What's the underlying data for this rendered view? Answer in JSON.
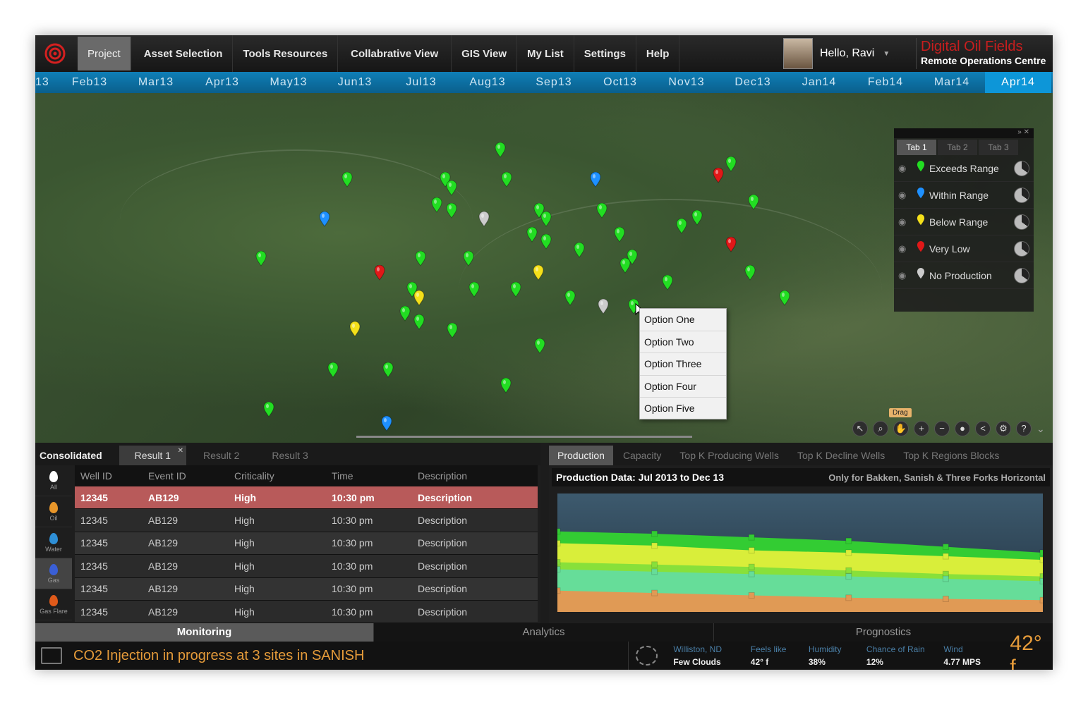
{
  "nav": {
    "items": [
      "Project",
      "Asset Selection",
      "Tools Resources",
      "Collabrative View",
      "GIS View",
      "My List",
      "Settings",
      "Help"
    ],
    "active": "Project",
    "user_greeting": "Hello, Ravi",
    "brand_title": "Digital Oil Fields",
    "brand_subtitle": "Remote Operations Centre"
  },
  "timeline": {
    "months": [
      "13",
      "Feb13",
      "Mar13",
      "Apr13",
      "May13",
      "Jun13",
      "Jul13",
      "Aug13",
      "Sep13",
      "Oct13",
      "Nov13",
      "Dec13",
      "Jan14",
      "Feb14",
      "Mar14",
      "Apr14"
    ],
    "active": "Apr14"
  },
  "legend": {
    "tabs": [
      "Tab 1",
      "Tab 2",
      "Tab 3"
    ],
    "items": [
      {
        "label": "Exceeds Range",
        "color": "#22dd22"
      },
      {
        "label": "Within Range",
        "color": "#1e90ff"
      },
      {
        "label": "Below Range",
        "color": "#f4e01a"
      },
      {
        "label": "Very Low",
        "color": "#e01818"
      },
      {
        "label": "No Production",
        "color": "#cccccc"
      }
    ]
  },
  "context_menu": [
    "Option One",
    "Option Two",
    "Option Three",
    "Option Four",
    "Option Five"
  ],
  "map_tools": {
    "drag_tip": "Drag"
  },
  "results": {
    "tabs": [
      "Consolidated",
      "Result 1",
      "Result 2",
      "Result 3"
    ],
    "filters": [
      "All",
      "Oil",
      "Water",
      "Gas",
      "Gas Flare"
    ],
    "columns": [
      "Well ID",
      "Event ID",
      "Criticality",
      "Time",
      "Description"
    ],
    "rows": [
      [
        "12345",
        "AB129",
        "High",
        "10:30 pm",
        "Description"
      ],
      [
        "12345",
        "AB129",
        "High",
        "10:30 pm",
        "Description"
      ],
      [
        "12345",
        "AB129",
        "High",
        "10:30 pm",
        "Description"
      ],
      [
        "12345",
        "AB129",
        "High",
        "10:30 pm",
        "Description"
      ],
      [
        "12345",
        "AB129",
        "High",
        "10:30 pm",
        "Description"
      ],
      [
        "12345",
        "AB129",
        "High",
        "10:30 pm",
        "Description"
      ]
    ]
  },
  "production": {
    "tabs": [
      "Production",
      "Capacity",
      "Top K Producing Wells",
      "Top K Decline Wells",
      "Top K Regions Blocks"
    ],
    "title": "Production Data: Jul 2013 to Dec 13",
    "note": "Only for Bakken, Sanish & Three Forks Horizontal"
  },
  "chart_data": {
    "type": "area",
    "title": "Production Data: Jul 2013 to Dec 13",
    "x": [
      0,
      1,
      2,
      3,
      4,
      5
    ],
    "ylim": [
      0,
      100
    ],
    "series": [
      {
        "name": "",
        "color": "#33cc33",
        "values": [
          68,
          66,
          63,
          60,
          55,
          50
        ]
      },
      {
        "name": "",
        "color": "#d9ee3a",
        "values": [
          58,
          56,
          52,
          50,
          47,
          44
        ]
      },
      {
        "name": "",
        "color": "#88e03a",
        "values": [
          42,
          40,
          38,
          35,
          32,
          30
        ]
      },
      {
        "name": "",
        "color": "#66dd99",
        "values": [
          36,
          34,
          32,
          30,
          28,
          26
        ]
      },
      {
        "name": "",
        "color": "#e09a55",
        "values": [
          18,
          16,
          14,
          12,
          11,
          10
        ]
      }
    ]
  },
  "bottom_nav": [
    "Monitoring",
    "Analytics",
    "Prognostics"
  ],
  "status": {
    "message": "CO2 Injection in progress at 3 sites in SANISH",
    "weather": [
      {
        "label": "Williston, ND",
        "value": "Few Clouds"
      },
      {
        "label": "Feels like",
        "value": "42° f"
      },
      {
        "label": "Humidity",
        "value": "38%"
      },
      {
        "label": "Chance of Rain",
        "value": "12%"
      },
      {
        "label": "Wind",
        "value": "4.77 MPS"
      }
    ],
    "temperature": "42° f"
  },
  "colors": {
    "accent": "#0d96d8",
    "brand": "#c81e1e",
    "status": "#e59b3a"
  }
}
